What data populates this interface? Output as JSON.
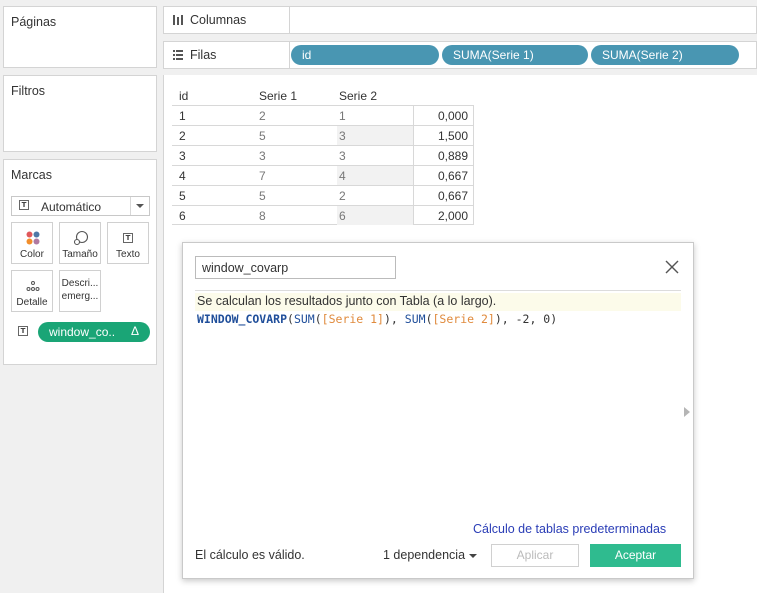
{
  "left_panel": {
    "pages_title": "Páginas",
    "filters_title": "Filtros",
    "marks_title": "Marcas",
    "mark_type": "Automático",
    "mark_buttons": {
      "color": "Color",
      "size": "Tamaño",
      "text": "Texto",
      "detail": "Detalle",
      "tooltip_line1": "Descri...",
      "tooltip_line2": "emerg..."
    },
    "mark_field_pill": "window_co..",
    "mark_field_delta": "Δ"
  },
  "shelves": {
    "columns_label": "Columnas",
    "rows_label": "Filas",
    "rows_pills": [
      "id",
      "SUMA(Serie 1)",
      "SUMA(Serie 2)"
    ]
  },
  "table": {
    "headers": [
      "id",
      "Serie 1",
      "Serie 2"
    ],
    "rows": [
      {
        "id": "1",
        "s1": "2",
        "s2": "1",
        "val": "0,000"
      },
      {
        "id": "2",
        "s1": "5",
        "s2": "3",
        "val": "1,500"
      },
      {
        "id": "3",
        "s1": "3",
        "s2": "3",
        "val": "0,889"
      },
      {
        "id": "4",
        "s1": "7",
        "s2": "4",
        "val": "0,667"
      },
      {
        "id": "5",
        "s1": "5",
        "s2": "2",
        "val": "0,667"
      },
      {
        "id": "6",
        "s1": "8",
        "s2": "6",
        "val": "2,000"
      }
    ]
  },
  "dialog": {
    "calc_name": "window_covarp",
    "info": "Se calculan los resultados junto con Tabla (a lo largo).",
    "formula": {
      "fn": "WINDOW_COVARP",
      "p1": "(",
      "sum1": "SUM",
      "o1": "(",
      "field1": "[Serie 1]",
      "c1": "),",
      "sp": " ",
      "sum2": "SUM",
      "o2": "(",
      "field2": "[Serie 2]",
      "c2": "),",
      "rest": " -2, 0)"
    },
    "default_link": "Cálculo de tablas predeterminadas",
    "valid_msg": "El cálculo es válido.",
    "dependency": "1 dependencia",
    "apply": "Aplicar",
    "accept": "Aceptar"
  }
}
